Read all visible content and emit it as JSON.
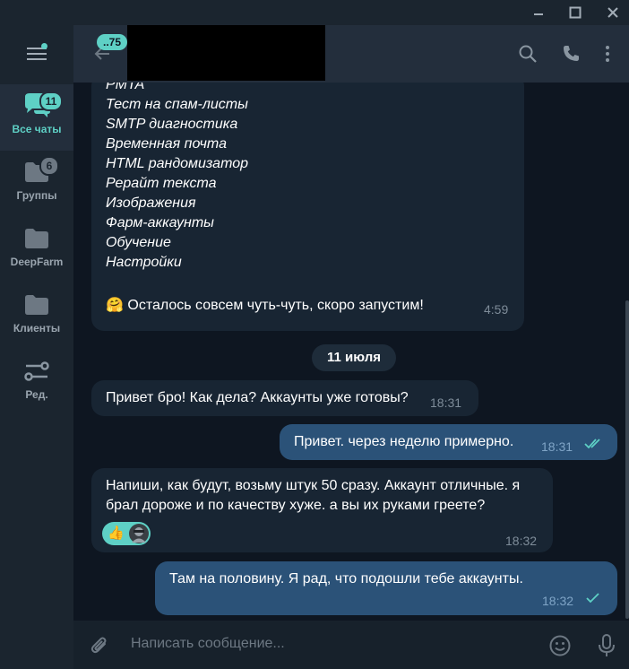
{
  "window": {
    "controls": [
      "minimize",
      "maximize",
      "close"
    ]
  },
  "sidebar": {
    "menu_icon": "hamburger-icon",
    "folders": [
      {
        "label": "Все чаты",
        "icon": "chats-icon",
        "badge": "11",
        "active": true
      },
      {
        "label": "Группы",
        "icon": "folder-icon",
        "badge": "6",
        "active": false
      },
      {
        "label": "DeepFarm",
        "icon": "folder-icon",
        "badge": "",
        "active": false
      },
      {
        "label": "Клиенты",
        "icon": "folder-icon",
        "badge": "",
        "active": false
      },
      {
        "label": "Ред.",
        "icon": "sliders-icon",
        "badge": "",
        "active": false
      }
    ]
  },
  "header": {
    "back_badge": "..75",
    "icons": [
      "search-icon",
      "phone-icon",
      "more-vert-icon"
    ]
  },
  "messages": {
    "menu_items": [
      "PMTA",
      "Тест на спам-листы",
      "SMTP диагностика",
      "Временная почта",
      "HTML рандомизатор",
      "Рерайт текста",
      "Изображения",
      "Фарм-аккаунты",
      "Обучение",
      "Настройки"
    ],
    "menu_footer": "🤗 Осталось совсем чуть-чуть, скоро запустим!",
    "menu_time": "4:59",
    "date_chip": "11 июля",
    "m1": {
      "text": "Привет бро! Как дела? Аккаунты уже готовы?",
      "time": "18:31"
    },
    "m2": {
      "text": "Привет. через неделю примерно.",
      "time": "18:31",
      "status": "read"
    },
    "m3": {
      "line1": "Напиши, как будут, возьму штук 50 сразу. Аккаунт отличные. я",
      "line2": "брал дороже и по качеству хуже. а вы их руками греете?",
      "time": "18:32",
      "reaction": "👍"
    },
    "m4": {
      "text": "Там на половину. Я рад, что подошли тебе аккаунты.",
      "time": "18:32",
      "status": "sent"
    }
  },
  "composer": {
    "placeholder": "Написать сообщение...",
    "icons": [
      "attach-icon",
      "emoji-icon",
      "mic-icon"
    ]
  },
  "colors": {
    "accent": "#5ed0c5",
    "incoming": "#182533",
    "outgoing": "#2b5278",
    "background": "#0e1621"
  }
}
